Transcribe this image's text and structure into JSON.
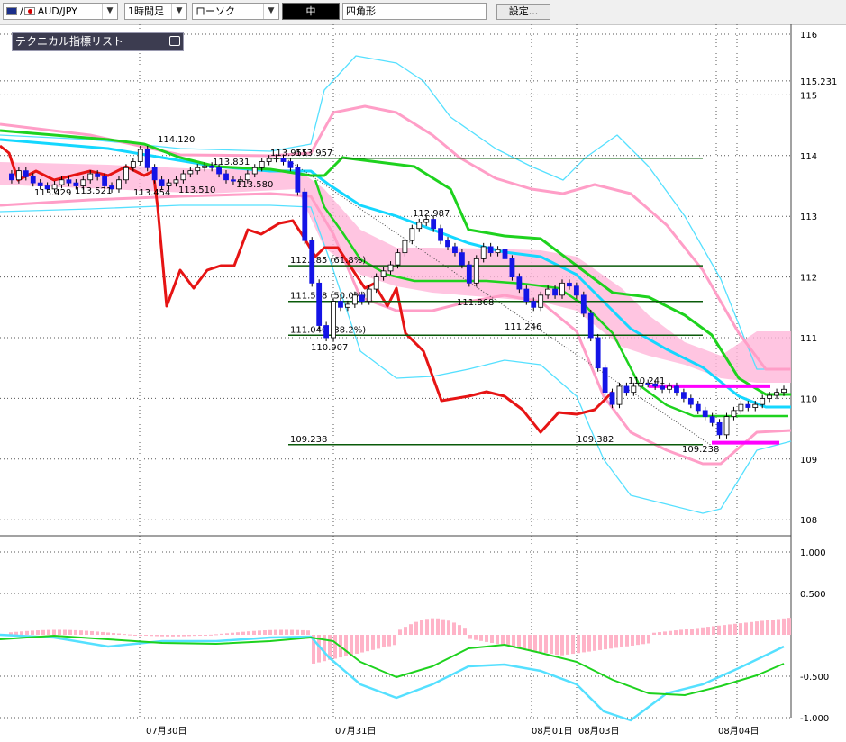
{
  "toolbar": {
    "symbol": "AUD/JPY",
    "timeframe": "1時間足",
    "chart_type": "ローソク",
    "line_width": "中",
    "shape": "四角形",
    "settings": "設定..."
  },
  "indicator_panel": {
    "title": "テクニカル指標リスト"
  },
  "colors": {
    "candle_up": "#ffffff",
    "candle_down": "#1414e6",
    "cloud": "#ffb6d9",
    "bb_outer": "#55e0ff",
    "bb_inner": "#ff9ec7",
    "ma_short": "#14d7ff",
    "ma_long": "#1ed21e",
    "lagging_span": "#e61414",
    "fib_line": "#0a5a0a",
    "support_line": "#ff00ff",
    "macd_hist": "#ffb4c8",
    "macd_line": "#55e0ff",
    "signal_line": "#1ed21e"
  },
  "chart_data": [
    {
      "type": "candlestick",
      "pair": "AUD/JPY",
      "timeframe": "1時間足",
      "ylim": [
        107.8,
        116.2
      ],
      "y_ticks": [
        "116",
        "115",
        "114",
        "113",
        "112",
        "111",
        "110",
        "109",
        "108"
      ],
      "current_price_label": "115.231",
      "x_labels": [
        "07月30日",
        "07月31日",
        "08月01日",
        "08月03日",
        "08月04日"
      ],
      "annotations": [
        "114.120",
        "113.429",
        "113.521",
        "113.454",
        "113.510",
        "113.831",
        "113.580",
        "113.955",
        "113.957",
        "112.987",
        "111.868",
        "111.246",
        "110.907",
        "109.382",
        "110.241",
        "109.238"
      ],
      "fibonacci_levels": [
        {
          "label": "112.185 (61.8%)",
          "value": 112.185
        },
        {
          "label": "111.598 (50.0%)",
          "value": 111.598
        },
        {
          "label": "111.040 (38.2%)",
          "value": 111.04
        },
        {
          "label": "109.238",
          "value": 109.238
        }
      ],
      "horizontal_levels": [
        113.957,
        112.185,
        111.598,
        111.04,
        109.238
      ],
      "support_resistance": [
        110.2,
        109.27
      ],
      "close_series": [
        113.7,
        113.6,
        113.75,
        113.65,
        113.55,
        113.5,
        113.45,
        113.52,
        113.6,
        113.55,
        113.5,
        113.6,
        113.7,
        113.65,
        113.5,
        113.45,
        113.6,
        113.8,
        113.9,
        114.1,
        113.8,
        113.6,
        113.5,
        113.55,
        113.6,
        113.7,
        113.75,
        113.8,
        113.83,
        113.8,
        113.7,
        113.6,
        113.58,
        113.6,
        113.7,
        113.8,
        113.9,
        113.95,
        113.96,
        113.9,
        113.8,
        113.4,
        112.6,
        111.9,
        111.2,
        111.0,
        111.6,
        111.5,
        111.55,
        111.7,
        111.6,
        111.8,
        112.0,
        112.1,
        112.2,
        112.4,
        112.6,
        112.8,
        112.9,
        112.95,
        112.8,
        112.6,
        112.5,
        112.4,
        112.2,
        111.9,
        112.3,
        112.5,
        112.4,
        112.45,
        112.3,
        112.0,
        111.8,
        111.6,
        111.5,
        111.7,
        111.8,
        111.7,
        111.9,
        111.85,
        111.7,
        111.4,
        111.0,
        110.5,
        110.1,
        109.9,
        110.2,
        110.1,
        110.2,
        110.25,
        110.24,
        110.2,
        110.15,
        110.2,
        110.1,
        110.0,
        109.9,
        109.8,
        109.7,
        109.6,
        109.4,
        109.7,
        109.8,
        109.9,
        109.85,
        109.9,
        110.0,
        110.05,
        110.1,
        110.15
      ]
    },
    {
      "type": "line",
      "name": "MACD",
      "ylim": [
        -1.0,
        1.0
      ],
      "y_ticks": [
        "1.000",
        "0.500",
        "-0.500",
        "-1.000"
      ],
      "x_labels": [
        "07月30日",
        "07月31日",
        "08月01日",
        "08月03日",
        "08月04日"
      ]
    }
  ]
}
